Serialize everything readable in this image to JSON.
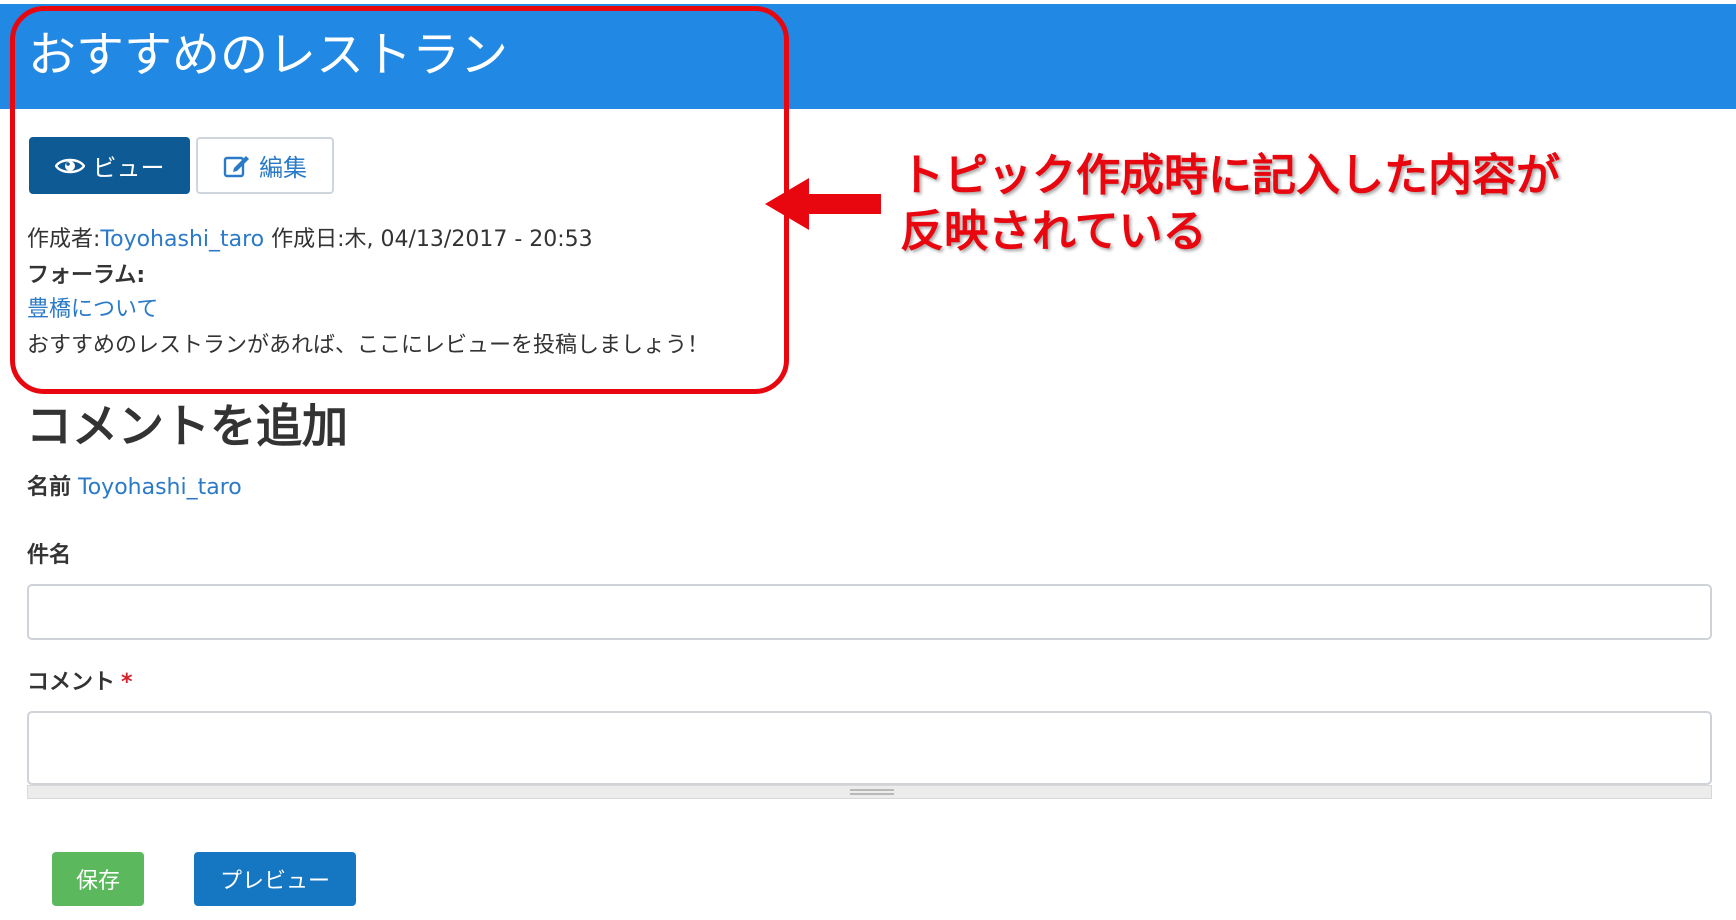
{
  "header": {
    "title": "おすすめのレストラン"
  },
  "tabs": [
    {
      "label": "ビュー",
      "icon": "eye-icon",
      "active": true
    },
    {
      "label": "編集",
      "icon": "edit-icon",
      "active": false
    }
  ],
  "topic": {
    "author_prefix": "作成者:",
    "author": "Toyohashi_taro",
    "date_prefix": " 作成日:",
    "date": "木, 04/13/2017 - 20:53",
    "forum_label": "フォーラム:",
    "forum_link": "豊橋について",
    "body": "おすすめのレストランがあれば、ここにレビューを投稿しましょう！"
  },
  "annotation": {
    "line1": "トピック作成時に記入した内容が",
    "line2": "反映されている",
    "color": "#e8060f"
  },
  "comment_form": {
    "title": "コメントを追加",
    "name_label": "名前",
    "name_value": "Toyohashi_taro",
    "subject_label": "件名",
    "subject_value": "",
    "comment_label": "コメント",
    "required_mark": "*",
    "comment_value": "",
    "save_label": "保存",
    "preview_label": "プレビュー"
  },
  "colors": {
    "header_bg": "#2188e4",
    "link": "#2b7ac7",
    "save_button": "#5cb85c",
    "preview_button": "#1576c2",
    "active_tab": "#0e5a94"
  }
}
